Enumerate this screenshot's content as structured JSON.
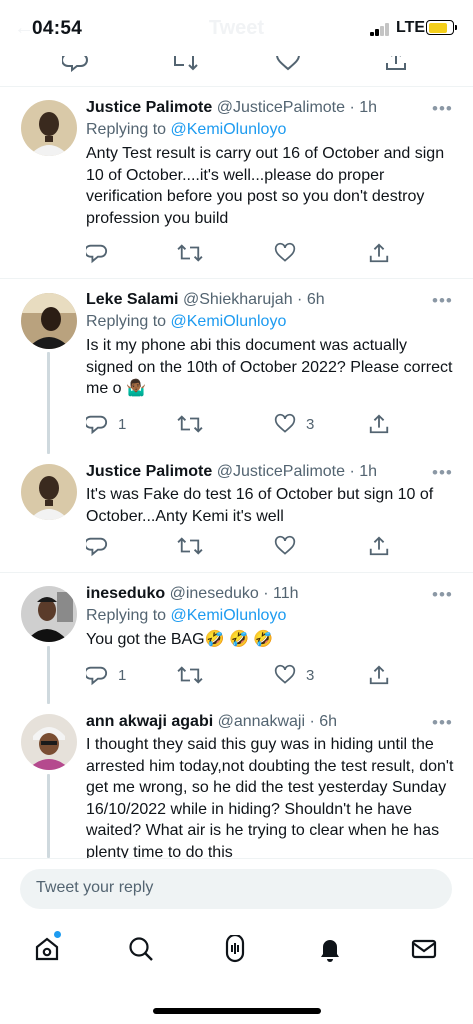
{
  "status_bar": {
    "time": "04:54",
    "network": "LTE",
    "ghost_title": "Tweet"
  },
  "tweets": [
    {
      "name": "Justice Palimote",
      "handle": "@JusticePalimote",
      "time": "1h",
      "replying_prefix": "Replying to",
      "replying_to": "@KemiOlunloyo",
      "text": "Anty Test result is carry out 16 of October and sign 10 of October....it's well...please do proper verification before you post so you don't destroy profession you build",
      "reply_count": "",
      "like_count": ""
    },
    {
      "name": "Leke Salami",
      "handle": "@Shiekharujah",
      "time": "6h",
      "replying_prefix": "Replying to",
      "replying_to": "@KemiOlunloyo",
      "text": "Is it my phone abi this document was actually signed on the 10th of October 2022?  Please correct me o 🤷🏾‍♂️",
      "reply_count": "1",
      "like_count": "3"
    },
    {
      "name": "Justice Palimote",
      "handle": "@JusticePalimote",
      "time": "1h",
      "text": "It's was Fake do test 16 of October but sign 10 of October...Anty Kemi it's well",
      "reply_count": "",
      "like_count": ""
    },
    {
      "name": "ineseduko",
      "handle": "@ineseduko",
      "time": "11h",
      "replying_prefix": "Replying to",
      "replying_to": "@KemiOlunloyo",
      "text": "You got the BAG🤣 🤣 🤣",
      "reply_count": "1",
      "like_count": "3"
    },
    {
      "name": "ann akwaji agabi",
      "handle": "@annakwaji",
      "time": "6h",
      "text": "I thought they said this guy was in hiding until the arrested him today,not doubting the test result, don't get me wrong, so he did the test yesterday Sunday 16/10/2022 while in hiding? Shouldn't he have waited? What air is he trying to clear when he has plenty time to do this"
    }
  ],
  "reply_bar": {
    "placeholder": "Tweet your reply"
  },
  "colors": {
    "accent": "#1d9bf0",
    "text": "#0f1419",
    "secondary": "#536471",
    "thread_line": "#cfd9de"
  },
  "nav": [
    "home-icon",
    "search-icon",
    "spaces-icon",
    "notifications-icon",
    "messages-icon"
  ]
}
